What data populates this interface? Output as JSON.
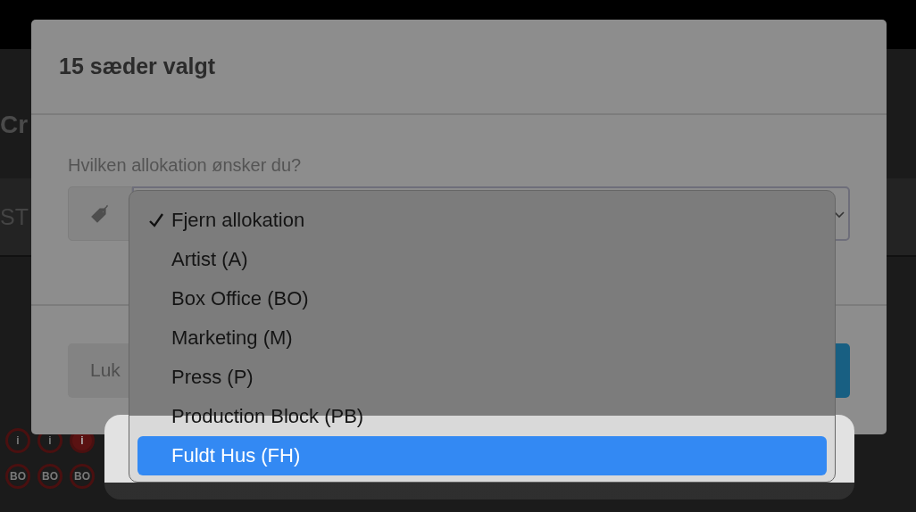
{
  "background_page": {
    "heading": "Cr",
    "section_label": "ST",
    "seat_rows": [
      {
        "seats": [
          {
            "label": "i",
            "filled": false
          },
          {
            "label": "i",
            "filled": false
          },
          {
            "label": "i",
            "filled": true
          }
        ]
      },
      {
        "seats": [
          {
            "label": "BO",
            "filled": false
          },
          {
            "label": "BO",
            "filled": false
          },
          {
            "label": "BO",
            "filled": false
          }
        ]
      }
    ]
  },
  "modal": {
    "title": "15 sæder valgt",
    "field_label": "Hvilken allokation ønsker du?",
    "close_button": "Luk"
  },
  "dropdown": {
    "options": [
      {
        "label": "Fjern allokation",
        "checked": true,
        "selected": false
      },
      {
        "label": "Artist (A)",
        "checked": false,
        "selected": false
      },
      {
        "label": "Box Office (BO)",
        "checked": false,
        "selected": false
      },
      {
        "label": "Marketing (M)",
        "checked": false,
        "selected": false
      },
      {
        "label": "Press (P)",
        "checked": false,
        "selected": false
      },
      {
        "label": "Production Block (PB)",
        "checked": false,
        "selected": false
      },
      {
        "label": "Fuldt Hus (FH)",
        "checked": false,
        "selected": true
      }
    ]
  }
}
